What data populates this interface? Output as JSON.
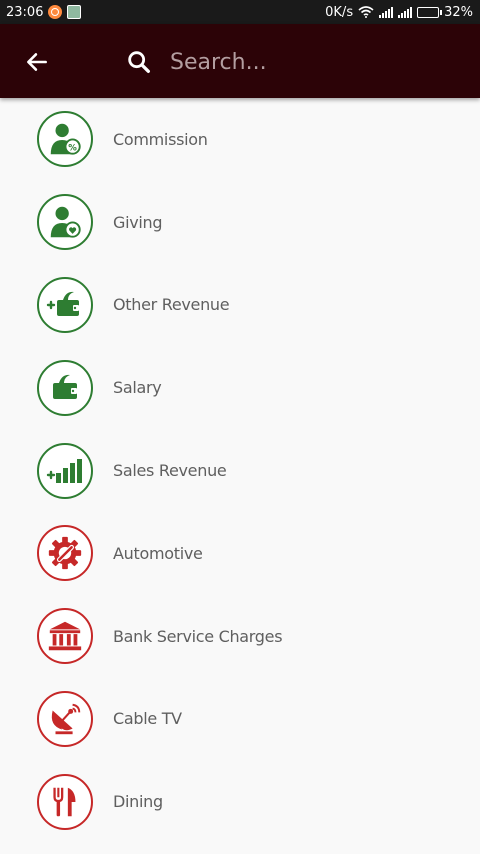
{
  "status_bar": {
    "time": "23:06",
    "network_speed": "0K/s",
    "battery": "32%",
    "battery_level": 0.32
  },
  "app_bar": {
    "back_icon": "arrow-left-icon",
    "search_icon": "search-icon",
    "search_placeholder": "Search...",
    "background": "#2c0307"
  },
  "colors": {
    "income": "#2e7d32",
    "expense": "#c62828"
  },
  "categories": [
    {
      "label": "Commission",
      "icon": "person-percent-icon",
      "kind": "income"
    },
    {
      "label": "Giving",
      "icon": "person-heart-icon",
      "kind": "income"
    },
    {
      "label": "Other Revenue",
      "icon": "wallet-plus-icon",
      "kind": "income"
    },
    {
      "label": "Salary",
      "icon": "wallet-icon",
      "kind": "income"
    },
    {
      "label": "Sales Revenue",
      "icon": "bars-plus-icon",
      "kind": "income"
    },
    {
      "label": "Automotive",
      "icon": "gear-wrench-icon",
      "kind": "expense"
    },
    {
      "label": "Bank Service Charges",
      "icon": "bank-icon",
      "kind": "expense"
    },
    {
      "label": "Cable TV",
      "icon": "satellite-dish-icon",
      "kind": "expense"
    },
    {
      "label": "Dining",
      "icon": "fork-knife-icon",
      "kind": "expense"
    }
  ]
}
